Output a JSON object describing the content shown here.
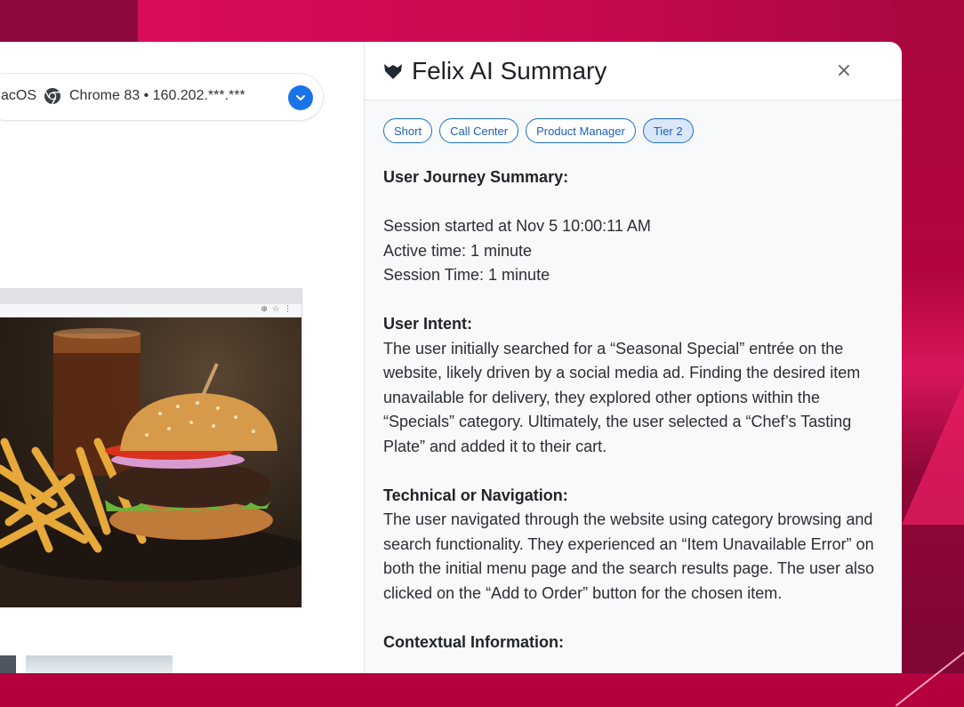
{
  "session": {
    "os": "acOS",
    "browser_info": "Chrome 83 • 160.202.***.***"
  },
  "summary_panel": {
    "title": "Felix AI Summary",
    "close_glyph": "×",
    "tags": [
      {
        "label": "Short",
        "active": false
      },
      {
        "label": "Call Center",
        "active": false
      },
      {
        "label": "Product Manager",
        "active": false
      },
      {
        "label": "Tier 2",
        "active": true
      }
    ],
    "journey": {
      "heading": "User Journey Summary:",
      "session_started": "Session started at Nov 5 10:00:11 AM",
      "active_time": "Active time: 1 minute",
      "session_time": "Session Time: 1 minute"
    },
    "intent": {
      "heading": "User Intent:",
      "text": "The user initially searched for a “Seasonal Special” entrée on the website, likely driven by a social media ad. Finding the desired item unavailable for delivery, they explored other options within the “Specials” category. Ultimately, the user selected a “Chef’s Tasting Plate” and added it to their cart."
    },
    "technical": {
      "heading": "Technical or Navigation:",
      "text": "The user navigated through the website using category browsing and search functionality. They experienced an “Item Unavailable Error” on both the initial menu page and the search results page. The user also clicked on the “Add to Order” button for the chosen item."
    },
    "contextual": {
      "heading": "Contextual Information:"
    }
  },
  "icons": {
    "chrome": "chrome-icon",
    "expand": "chevron-down-icon",
    "logo": "felix-logo-icon",
    "close": "close-icon"
  },
  "colors": {
    "brand_pink": "#d90d5b",
    "accent_blue": "#1a73e8",
    "tag_border": "#1b6fd1"
  }
}
